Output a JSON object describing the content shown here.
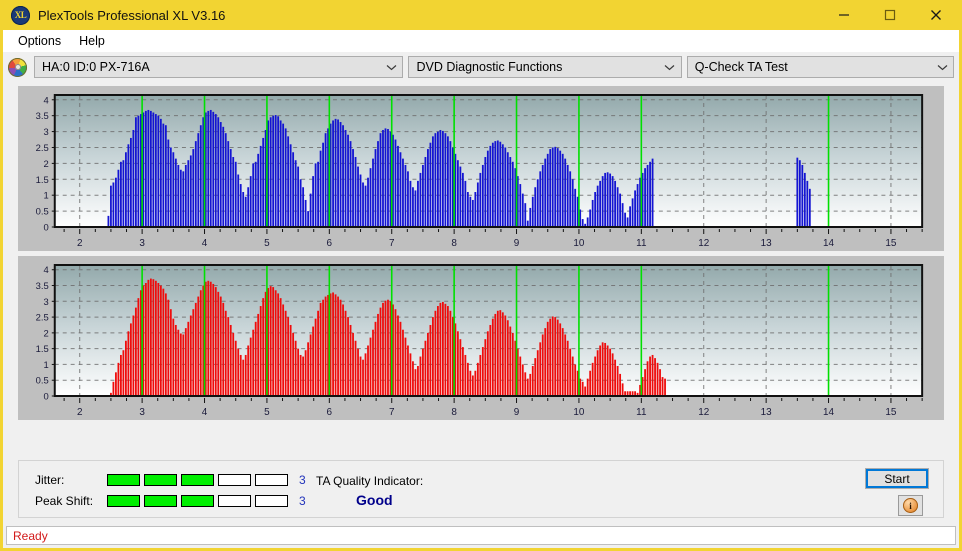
{
  "window": {
    "title": "PlexTools Professional XL V3.16",
    "app_icon": "xl-logo-icon",
    "accent_color": "#f2d432",
    "controls": {
      "minimize": "minimize-icon",
      "maximize": "maximize-icon",
      "close": "close-icon"
    }
  },
  "menu": {
    "items": [
      {
        "label": "Options"
      },
      {
        "label": "Help"
      }
    ]
  },
  "selectors": {
    "drive_icon": "optical-disc-icon",
    "drive": {
      "value": "HA:0 ID:0  PX-716A",
      "chevron": "chevron-down-icon"
    },
    "function": {
      "value": "DVD Diagnostic Functions",
      "chevron": "chevron-down-icon"
    },
    "test": {
      "value": "Q-Check TA Test",
      "chevron": "chevron-down-icon"
    }
  },
  "results": {
    "jitter": {
      "label": "Jitter:",
      "value": "3",
      "segments_total": 5,
      "segments_on": 3
    },
    "peak_shift": {
      "label": "Peak Shift:",
      "value": "3",
      "segments_total": 5,
      "segments_on": 3
    },
    "ta_quality": {
      "label": "TA Quality Indicator:",
      "value": "Good",
      "value_color": "#00008b"
    },
    "start_button": "Start",
    "info_button": "info-icon"
  },
  "status": {
    "text": "Ready",
    "color": "#d21a1a"
  },
  "chart_data": [
    {
      "type": "bar",
      "name": "jitter-chart",
      "title": "",
      "xlabel": "",
      "ylabel": "",
      "series_color": "#1414d2",
      "xlim": [
        1.6,
        15.5
      ],
      "ylim": [
        0,
        4.15
      ],
      "yticks": [
        0,
        0.5,
        1,
        1.5,
        2,
        2.5,
        3,
        3.5,
        4
      ],
      "ytick_labels": [
        "0",
        "0.5",
        "1",
        "1.5",
        "2",
        "2.5",
        "3",
        "3.5",
        "4"
      ],
      "xticks": [
        2,
        3,
        4,
        5,
        6,
        7,
        8,
        9,
        10,
        11,
        12,
        13,
        14,
        15
      ],
      "xtick_labels": [
        "2",
        "3",
        "4",
        "5",
        "6",
        "7",
        "8",
        "9",
        "10",
        "11",
        "12",
        "13",
        "14",
        "15"
      ],
      "minor_tick_step": 0.25,
      "grid": true,
      "marker_lines": [
        3,
        4,
        5,
        6,
        7,
        8,
        9,
        10,
        11,
        14
      ],
      "marker_color": "#00e000",
      "bar_step": 0.04,
      "x": [
        2.46,
        2.5,
        2.54,
        2.58,
        2.62,
        2.66,
        2.7,
        2.74,
        2.78,
        2.82,
        2.86,
        2.9,
        2.94,
        2.98,
        3.02,
        3.06,
        3.1,
        3.14,
        3.18,
        3.22,
        3.26,
        3.3,
        3.34,
        3.38,
        3.42,
        3.46,
        3.5,
        3.54,
        3.58,
        3.62,
        3.66,
        3.7,
        3.74,
        3.78,
        3.82,
        3.86,
        3.9,
        3.94,
        3.98,
        4.02,
        4.06,
        4.1,
        4.14,
        4.18,
        4.22,
        4.26,
        4.3,
        4.34,
        4.38,
        4.42,
        4.46,
        4.5,
        4.54,
        4.58,
        4.62,
        4.66,
        4.7,
        4.74,
        4.78,
        4.82,
        4.86,
        4.9,
        4.94,
        4.98,
        5.02,
        5.06,
        5.1,
        5.14,
        5.18,
        5.22,
        5.26,
        5.3,
        5.34,
        5.38,
        5.42,
        5.46,
        5.5,
        5.54,
        5.58,
        5.62,
        5.66,
        5.7,
        5.74,
        5.78,
        5.82,
        5.86,
        5.9,
        5.94,
        5.98,
        6.02,
        6.06,
        6.1,
        6.14,
        6.18,
        6.22,
        6.26,
        6.3,
        6.34,
        6.38,
        6.42,
        6.46,
        6.5,
        6.54,
        6.58,
        6.62,
        6.66,
        6.7,
        6.74,
        6.78,
        6.82,
        6.86,
        6.9,
        6.94,
        6.98,
        7.02,
        7.06,
        7.1,
        7.14,
        7.18,
        7.22,
        7.26,
        7.3,
        7.34,
        7.38,
        7.42,
        7.46,
        7.5,
        7.54,
        7.58,
        7.62,
        7.66,
        7.7,
        7.74,
        7.78,
        7.82,
        7.86,
        7.9,
        7.94,
        7.98,
        8.02,
        8.06,
        8.1,
        8.14,
        8.18,
        8.22,
        8.26,
        8.3,
        8.34,
        8.38,
        8.42,
        8.46,
        8.5,
        8.54,
        8.58,
        8.62,
        8.66,
        8.7,
        8.74,
        8.78,
        8.82,
        8.86,
        8.9,
        8.94,
        8.98,
        9.02,
        9.06,
        9.1,
        9.14,
        9.18,
        9.22,
        9.26,
        9.3,
        9.34,
        9.38,
        9.42,
        9.46,
        9.5,
        9.54,
        9.58,
        9.62,
        9.66,
        9.7,
        9.74,
        9.78,
        9.82,
        9.86,
        9.9,
        9.94,
        9.98,
        10.02,
        10.06,
        10.1,
        10.14,
        10.18,
        10.22,
        10.26,
        10.3,
        10.34,
        10.38,
        10.42,
        10.46,
        10.5,
        10.54,
        10.58,
        10.62,
        10.66,
        10.7,
        10.74,
        10.78,
        10.82,
        10.86,
        10.9,
        10.94,
        10.98,
        11.02,
        11.06,
        11.1,
        11.14,
        11.18,
        13.5,
        13.54,
        13.58,
        13.62,
        13.66,
        13.7,
        13.74,
        13.78,
        13.82,
        13.86,
        13.9,
        13.94,
        13.98,
        14.02,
        14.06,
        14.1,
        14.14
      ],
      "values": [
        0.35,
        1.3,
        1.4,
        1.55,
        1.8,
        2.05,
        2.1,
        2.35,
        2.6,
        2.8,
        3.05,
        3.45,
        3.5,
        3.55,
        3.6,
        3.65,
        3.68,
        3.65,
        3.6,
        3.55,
        3.5,
        3.4,
        3.25,
        3.2,
        2.75,
        2.5,
        2.35,
        2.15,
        1.95,
        1.8,
        1.75,
        1.95,
        2.1,
        2.25,
        2.45,
        2.7,
        2.95,
        3.2,
        3.45,
        3.6,
        3.65,
        3.68,
        3.62,
        3.55,
        3.45,
        3.3,
        3.15,
        2.95,
        2.7,
        2.45,
        2.2,
        2.05,
        1.65,
        1.35,
        1.1,
        0.95,
        1.25,
        1.6,
        2.0,
        2.05,
        2.3,
        2.55,
        2.8,
        3.05,
        3.35,
        3.45,
        3.5,
        3.52,
        3.48,
        3.35,
        3.25,
        3.1,
        2.85,
        2.6,
        2.35,
        2.1,
        1.9,
        1.5,
        1.25,
        0.85,
        0.5,
        1.05,
        1.6,
        2.0,
        2.05,
        2.4,
        2.65,
        2.95,
        3.1,
        3.25,
        3.35,
        3.4,
        3.38,
        3.3,
        3.2,
        3.05,
        2.9,
        2.7,
        2.45,
        2.2,
        1.9,
        1.65,
        1.4,
        1.3,
        1.55,
        1.85,
        2.15,
        2.45,
        2.7,
        2.95,
        3.05,
        3.1,
        3.08,
        3.0,
        2.9,
        2.75,
        2.55,
        2.35,
        2.15,
        1.95,
        1.75,
        1.45,
        1.25,
        1.15,
        1.45,
        1.7,
        1.95,
        2.2,
        2.45,
        2.65,
        2.85,
        2.95,
        3.0,
        3.05,
        3.02,
        2.95,
        2.85,
        2.7,
        2.5,
        2.3,
        2.1,
        1.9,
        1.7,
        1.45,
        1.1,
        0.95,
        0.85,
        1.1,
        1.4,
        1.7,
        1.95,
        2.2,
        2.4,
        2.55,
        2.65,
        2.7,
        2.72,
        2.68,
        2.6,
        2.5,
        2.35,
        2.2,
        2.05,
        1.85,
        1.6,
        1.35,
        1.05,
        0.75,
        0.2,
        0.6,
        0.95,
        1.25,
        1.5,
        1.75,
        1.95,
        2.15,
        2.3,
        2.45,
        2.5,
        2.52,
        2.48,
        2.4,
        2.3,
        2.15,
        1.95,
        1.75,
        1.5,
        1.2,
        0.95,
        0.55,
        0.25,
        0.1,
        0.3,
        0.55,
        0.85,
        1.1,
        1.3,
        1.45,
        1.6,
        1.7,
        1.72,
        1.68,
        1.6,
        1.45,
        1.25,
        1.05,
        0.75,
        0.45,
        0.3,
        0.65,
        0.9,
        1.15,
        1.35,
        1.55,
        1.7,
        1.85,
        1.95,
        2.05,
        2.15,
        2.18,
        2.1,
        1.95,
        1.7,
        1.45,
        1.2
      ]
    },
    {
      "type": "bar",
      "name": "peak-shift-chart",
      "title": "",
      "xlabel": "",
      "ylabel": "",
      "series_color": "#ef0c0c",
      "xlim": [
        1.6,
        15.5
      ],
      "ylim": [
        0,
        4.15
      ],
      "yticks": [
        0,
        0.5,
        1,
        1.5,
        2,
        2.5,
        3,
        3.5,
        4
      ],
      "ytick_labels": [
        "0",
        "0.5",
        "1",
        "1.5",
        "2",
        "2.5",
        "3",
        "3.5",
        "4"
      ],
      "xticks": [
        2,
        3,
        4,
        5,
        6,
        7,
        8,
        9,
        10,
        11,
        12,
        13,
        14,
        15
      ],
      "xtick_labels": [
        "2",
        "3",
        "4",
        "5",
        "6",
        "7",
        "8",
        "9",
        "10",
        "11",
        "12",
        "13",
        "14",
        "15"
      ],
      "minor_tick_step": 0.25,
      "grid": true,
      "marker_lines": [
        3,
        4,
        5,
        6,
        7,
        8,
        9,
        10,
        11,
        14
      ],
      "marker_color": "#00e000",
      "bar_step": 0.04,
      "x": [
        2.5,
        2.54,
        2.58,
        2.62,
        2.66,
        2.7,
        2.74,
        2.78,
        2.82,
        2.86,
        2.9,
        2.94,
        2.98,
        3.02,
        3.06,
        3.1,
        3.14,
        3.18,
        3.22,
        3.26,
        3.3,
        3.34,
        3.38,
        3.42,
        3.46,
        3.5,
        3.54,
        3.58,
        3.62,
        3.66,
        3.7,
        3.74,
        3.78,
        3.82,
        3.86,
        3.9,
        3.94,
        3.98,
        4.02,
        4.06,
        4.1,
        4.14,
        4.18,
        4.22,
        4.26,
        4.3,
        4.34,
        4.38,
        4.42,
        4.46,
        4.5,
        4.54,
        4.58,
        4.62,
        4.66,
        4.7,
        4.74,
        4.78,
        4.82,
        4.86,
        4.9,
        4.94,
        4.98,
        5.02,
        5.06,
        5.1,
        5.14,
        5.18,
        5.22,
        5.26,
        5.3,
        5.34,
        5.38,
        5.42,
        5.46,
        5.5,
        5.54,
        5.58,
        5.62,
        5.66,
        5.7,
        5.74,
        5.78,
        5.82,
        5.86,
        5.9,
        5.94,
        5.98,
        6.02,
        6.06,
        6.1,
        6.14,
        6.18,
        6.22,
        6.26,
        6.3,
        6.34,
        6.38,
        6.42,
        6.46,
        6.5,
        6.54,
        6.58,
        6.62,
        6.66,
        6.7,
        6.74,
        6.78,
        6.82,
        6.86,
        6.9,
        6.94,
        6.98,
        7.02,
        7.06,
        7.1,
        7.14,
        7.18,
        7.22,
        7.26,
        7.3,
        7.34,
        7.38,
        7.42,
        7.46,
        7.5,
        7.54,
        7.58,
        7.62,
        7.66,
        7.7,
        7.74,
        7.78,
        7.82,
        7.86,
        7.9,
        7.94,
        7.98,
        8.02,
        8.06,
        8.1,
        8.14,
        8.18,
        8.22,
        8.26,
        8.3,
        8.34,
        8.38,
        8.42,
        8.46,
        8.5,
        8.54,
        8.58,
        8.62,
        8.66,
        8.7,
        8.74,
        8.78,
        8.82,
        8.86,
        8.9,
        8.94,
        8.98,
        9.02,
        9.06,
        9.1,
        9.14,
        9.18,
        9.22,
        9.26,
        9.3,
        9.34,
        9.38,
        9.42,
        9.46,
        9.5,
        9.54,
        9.58,
        9.62,
        9.66,
        9.7,
        9.74,
        9.78,
        9.82,
        9.86,
        9.9,
        9.94,
        9.98,
        10.02,
        10.06,
        10.1,
        10.14,
        10.18,
        10.22,
        10.26,
        10.3,
        10.34,
        10.38,
        10.42,
        10.46,
        10.5,
        10.54,
        10.58,
        10.62,
        10.66,
        10.7,
        10.74,
        10.78,
        10.82,
        10.86,
        10.9,
        10.94,
        10.98,
        11.02,
        11.06,
        11.1,
        11.14,
        11.18,
        11.22,
        11.26,
        11.3,
        11.34,
        11.38,
        11.42,
        11.46,
        13.78,
        13.82,
        13.86,
        13.9,
        13.94,
        13.98,
        14.02,
        14.06,
        14.1,
        14.14,
        14.18,
        14.22
      ],
      "values": [
        0.1,
        0.45,
        0.75,
        1.05,
        1.3,
        1.45,
        1.75,
        2.05,
        2.3,
        2.55,
        2.8,
        3.1,
        3.35,
        3.5,
        3.58,
        3.68,
        3.72,
        3.7,
        3.65,
        3.58,
        3.5,
        3.4,
        3.25,
        3.05,
        2.75,
        2.45,
        2.25,
        2.1,
        1.98,
        1.95,
        2.15,
        2.35,
        2.55,
        2.75,
        2.95,
        3.15,
        3.35,
        3.5,
        3.62,
        3.65,
        3.62,
        3.55,
        3.45,
        3.3,
        3.15,
        2.95,
        2.7,
        2.5,
        2.25,
        2.0,
        1.75,
        1.5,
        1.3,
        1.15,
        1.3,
        1.6,
        1.85,
        2.1,
        2.35,
        2.6,
        2.85,
        3.1,
        3.3,
        3.42,
        3.48,
        3.45,
        3.35,
        3.25,
        3.1,
        2.9,
        2.7,
        2.5,
        2.25,
        2.0,
        1.75,
        1.5,
        1.3,
        1.25,
        1.45,
        1.7,
        1.95,
        2.2,
        2.45,
        2.7,
        2.95,
        3.05,
        3.15,
        3.2,
        3.25,
        3.28,
        3.22,
        3.15,
        3.05,
        2.9,
        2.7,
        2.5,
        2.25,
        2.0,
        1.75,
        1.5,
        1.25,
        1.15,
        1.35,
        1.6,
        1.85,
        2.1,
        2.35,
        2.6,
        2.8,
        2.95,
        3.02,
        3.05,
        3.0,
        2.9,
        2.75,
        2.55,
        2.35,
        2.1,
        1.85,
        1.6,
        1.35,
        1.1,
        0.85,
        0.95,
        1.25,
        1.5,
        1.75,
        2.0,
        2.25,
        2.5,
        2.7,
        2.85,
        2.95,
        2.98,
        2.92,
        2.85,
        2.7,
        2.5,
        2.3,
        2.05,
        1.8,
        1.55,
        1.3,
        1.05,
        0.8,
        0.65,
        0.8,
        1.05,
        1.3,
        1.55,
        1.8,
        2.05,
        2.25,
        2.45,
        2.6,
        2.7,
        2.72,
        2.65,
        2.55,
        2.4,
        2.2,
        2.0,
        1.75,
        1.5,
        1.25,
        1.0,
        0.75,
        0.55,
        0.7,
        0.95,
        1.2,
        1.45,
        1.7,
        1.95,
        2.15,
        2.35,
        2.45,
        2.52,
        2.5,
        2.42,
        2.3,
        2.15,
        1.95,
        1.75,
        1.5,
        1.25,
        1.0,
        0.8,
        0.55,
        0.45,
        0.3,
        0.55,
        0.8,
        1.05,
        1.25,
        1.45,
        1.6,
        1.7,
        1.68,
        1.6,
        1.5,
        1.35,
        1.15,
        0.95,
        0.7,
        0.4,
        0.15,
        0.15,
        0.15,
        0.15,
        0.15,
        0.1,
        0.35,
        0.6,
        0.85,
        1.1,
        1.25,
        1.3,
        1.2,
        1.05,
        0.85,
        0.6,
        0.55
      ]
    }
  ]
}
